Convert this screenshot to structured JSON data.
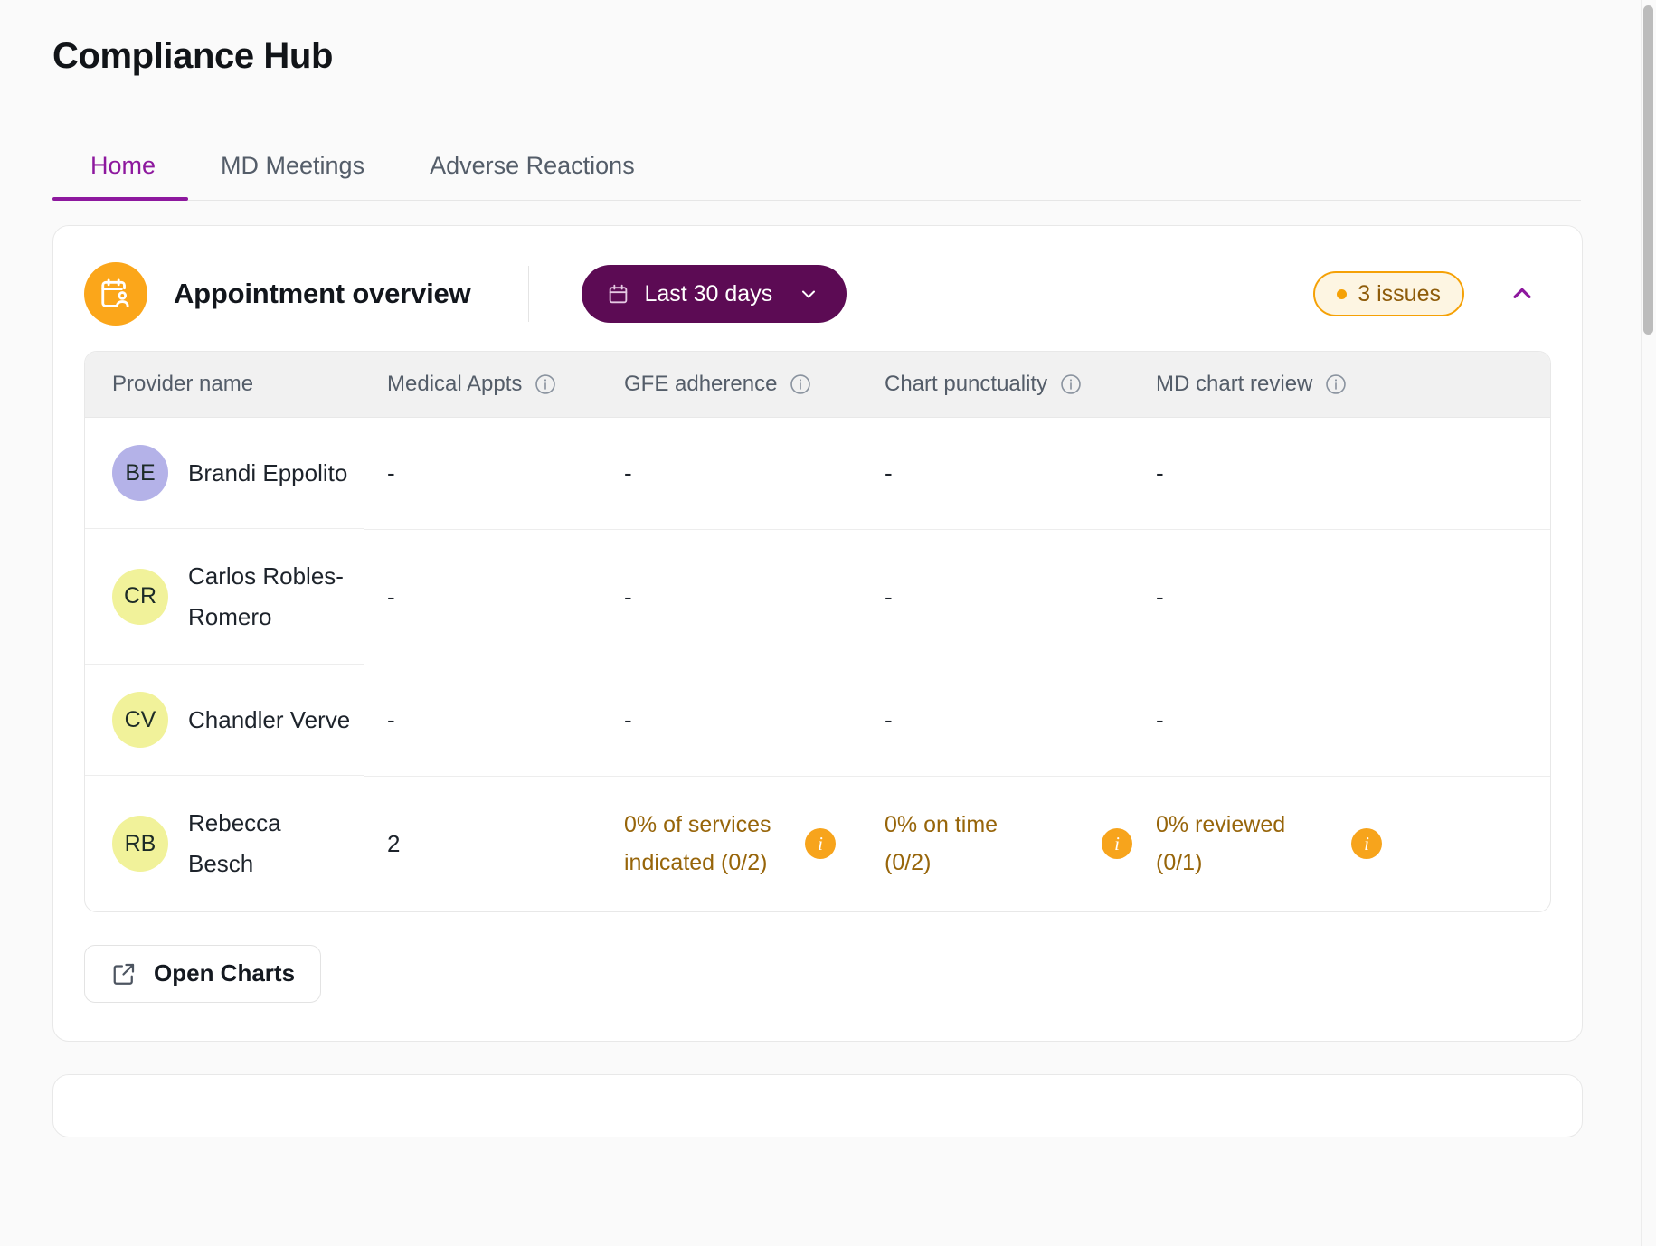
{
  "page": {
    "title": "Compliance Hub"
  },
  "tabs": [
    {
      "label": "Home",
      "active": true
    },
    {
      "label": "MD Meetings",
      "active": false
    },
    {
      "label": "Adverse Reactions",
      "active": false
    }
  ],
  "card": {
    "icon": "calendar-person-icon",
    "title": "Appointment overview",
    "date_range": {
      "label": "Last 30 days",
      "icon": "calendar-icon",
      "chevron": "chevron-down-icon"
    },
    "issues_badge": {
      "label": "3 issues",
      "count": 3,
      "dot_color": "#f5a106",
      "border_color": "#f5a106",
      "background_color": "#fdf5e2",
      "text_color": "#8e5c0a"
    },
    "collapse": {
      "icon": "chevron-up-icon",
      "color": "#8d189e"
    },
    "table": {
      "columns": [
        {
          "label": "Provider name",
          "info": false
        },
        {
          "label": "Medical Appts",
          "info": true
        },
        {
          "label": "GFE adherence",
          "info": true
        },
        {
          "label": "Chart punctuality",
          "info": true
        },
        {
          "label": "MD chart review",
          "info": true
        }
      ],
      "rows": [
        {
          "initials": "BE",
          "avatar_color": "#b4b2e8",
          "name": "Brandi Eppolito",
          "medical_appts": "-",
          "gfe_adherence": "-",
          "chart_punctuality": "-",
          "md_chart_review": "-",
          "warning": false
        },
        {
          "initials": "CR",
          "avatar_color": "#f1f29a",
          "name": "Carlos Robles-Romero",
          "medical_appts": "-",
          "gfe_adherence": "-",
          "chart_punctuality": "-",
          "md_chart_review": "-",
          "warning": false
        },
        {
          "initials": "CV",
          "avatar_color": "#f1f29a",
          "name": "Chandler Verve",
          "medical_appts": "-",
          "gfe_adherence": "-",
          "chart_punctuality": "-",
          "md_chart_review": "-",
          "warning": false
        },
        {
          "initials": "RB",
          "avatar_color": "#f1f29a",
          "name": "Rebecca Besch",
          "medical_appts": "2",
          "gfe_adherence": "0% of services indicated (0/2)",
          "chart_punctuality": "0% on time (0/2)",
          "md_chart_review": "0% reviewed (0/1)",
          "warning": true
        }
      ]
    },
    "footer": {
      "open_charts_label": "Open Charts",
      "open_charts_icon": "external-link-icon"
    }
  },
  "theme": {
    "accent_purple": "#8d189e",
    "pill_purple": "#5c0b54",
    "orange": "#fba61a",
    "warning_text": "#97650a"
  }
}
